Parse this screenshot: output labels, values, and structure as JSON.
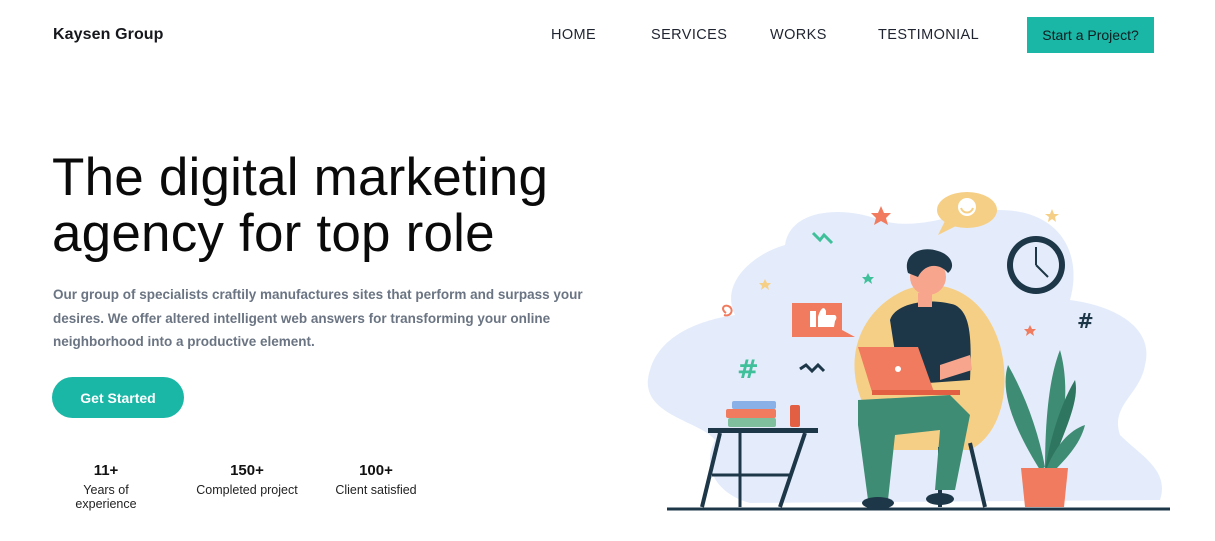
{
  "nav": {
    "brand": "Kaysen Group",
    "items": [
      {
        "label": "HOME"
      },
      {
        "label": "SERVICES"
      },
      {
        "label": "WORKS"
      },
      {
        "label": "TESTIMONIAL"
      }
    ],
    "cta_label": "Start a Project?"
  },
  "hero": {
    "title_line1": "The digital marketing",
    "title_line2": "agency for top role",
    "description": "Our group of specialists craftily manufactures sites that perform and surpass your desires. We offer altered intelligent web answers for transforming your online neighborhood into a productive element.",
    "button_label": "Get Started"
  },
  "stats": [
    {
      "value": "11+",
      "label": "Years of experience"
    },
    {
      "value": "150+",
      "label": "Completed project"
    },
    {
      "value": "100+",
      "label": "Client satisfied"
    }
  ],
  "colors": {
    "accent": "#1ab6a6",
    "text_muted": "#6a7482",
    "illustration_blob": "#e4ecfb",
    "illustration_dark": "#1d3748",
    "illustration_coral": "#f07b5e"
  },
  "illustration": {
    "subject": "person-with-laptop-in-chair",
    "icons": [
      "thumbs-up-icon",
      "clock-icon",
      "smiley-speech-bubble-icon",
      "hashtag-icon",
      "star-icon",
      "plant-icon",
      "books-icon",
      "table-icon"
    ]
  }
}
